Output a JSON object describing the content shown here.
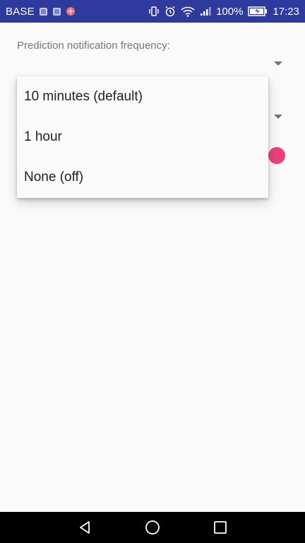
{
  "status_bar": {
    "carrier": "BASE",
    "battery": "100%",
    "time": "17:23",
    "icons": [
      "sim-icon",
      "sim-icon",
      "app-notification-icon",
      "vibrate-icon",
      "alarm-icon",
      "wifi-icon",
      "signal-icon",
      "battery-icon"
    ]
  },
  "settings": {
    "prediction_label": "Prediction notification frequency:"
  },
  "dropdown": {
    "options": [
      "10 minutes (default)",
      "1 hour",
      "None (off)"
    ]
  },
  "colors": {
    "status_bar": "#2f3a9e",
    "accent": "#ec407a",
    "background": "#fafafa",
    "nav_bar": "#000000"
  },
  "nav": {
    "icons": [
      "back-icon",
      "home-icon",
      "recents-icon"
    ]
  }
}
